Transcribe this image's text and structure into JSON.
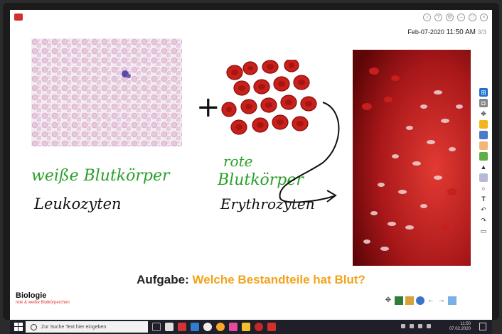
{
  "header": {
    "date": "Feb-07-2020",
    "time": "11:50 AM",
    "page": "3/3",
    "icons": [
      "bell-icon",
      "help-icon",
      "settings-icon",
      "minimize-icon",
      "fullscreen-icon",
      "close-icon"
    ]
  },
  "board": {
    "handwriting": {
      "wbc_line1": "weiße Blutkörper",
      "wbc_line2": "Leukozyten",
      "rbc_line1": "rote",
      "rbc_line2": "Blutkörper",
      "rbc_line3": "Erythrozyten",
      "plus": "+"
    },
    "ink_colors": {
      "green": "#2aa02a",
      "black": "#111111"
    }
  },
  "task": {
    "keyword": "Aufgabe:",
    "question": "Welche Bestandteile hat Blut?",
    "keyword_color": "#222222",
    "question_color": "#f3a31b"
  },
  "course": {
    "title": "Biologie",
    "subtitle": "rote & weiße Blutkörperchen"
  },
  "sidebar_tools": [
    "windows-icon",
    "screenshot-icon",
    "move-icon",
    "folder-icon",
    "eraser-icon",
    "hand-icon",
    "image-icon",
    "pen-icon",
    "highlighter-icon",
    "circle-icon",
    "text-icon",
    "undo-icon",
    "redo-icon",
    "board-icon"
  ],
  "bottom_tools": [
    "move-icon",
    "whiteboard-icon",
    "book-icon",
    "globe-icon",
    "arrow-left-icon",
    "arrow-right-icon",
    "screen-icon"
  ],
  "taskbar": {
    "search_placeholder": "Zur Suche Text hier eingeben",
    "clock_time": "11:50",
    "clock_date": "07.02.2020"
  }
}
